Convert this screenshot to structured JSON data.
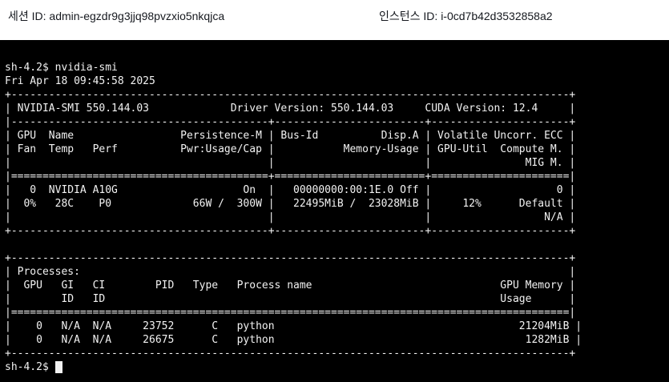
{
  "header": {
    "session_label": "세션 ID: admin-egzdr9g3jjq98pvzxio5nkqjca",
    "instance_label": "인스턴스 ID: i-0cd7b42d3532858a2"
  },
  "terminal": {
    "lines": [
      "sh-4.2$ nvidia-smi",
      "Fri Apr 18 09:45:58 2025",
      "+-----------------------------------------------------------------------------------------+",
      "| NVIDIA-SMI 550.144.03             Driver Version: 550.144.03     CUDA Version: 12.4     |",
      "|-----------------------------------------+------------------------+----------------------+",
      "| GPU  Name                 Persistence-M | Bus-Id          Disp.A | Volatile Uncorr. ECC |",
      "| Fan  Temp   Perf          Pwr:Usage/Cap |           Memory-Usage | GPU-Util  Compute M. |",
      "|                                         |                        |               MIG M. |",
      "|=========================================+========================+======================|",
      "|   0  NVIDIA A10G                    On  |   00000000:00:1E.0 Off |                    0 |",
      "|  0%   28C    P0             66W /  300W |   22495MiB /  23028MiB |     12%      Default |",
      "|                                         |                        |                  N/A |",
      "+-----------------------------------------+------------------------+----------------------+",
      "",
      "+-----------------------------------------------------------------------------------------+",
      "| Processes:                                                                              |",
      "|  GPU   GI   CI        PID   Type   Process name                              GPU Memory |",
      "|        ID   ID                                                               Usage      |",
      "|=========================================================================================|",
      "|    0   N/A  N/A     23752      C   python                                       21204MiB |",
      "|    0   N/A  N/A     26675      C   python                                        1282MiB |",
      "+-----------------------------------------------------------------------------------------+"
    ],
    "prompt": "sh-4.2$"
  },
  "colors": {
    "terminal_bg": "#000000",
    "terminal_fg": "#f2f2f2",
    "header_bg": "#ffffff"
  }
}
